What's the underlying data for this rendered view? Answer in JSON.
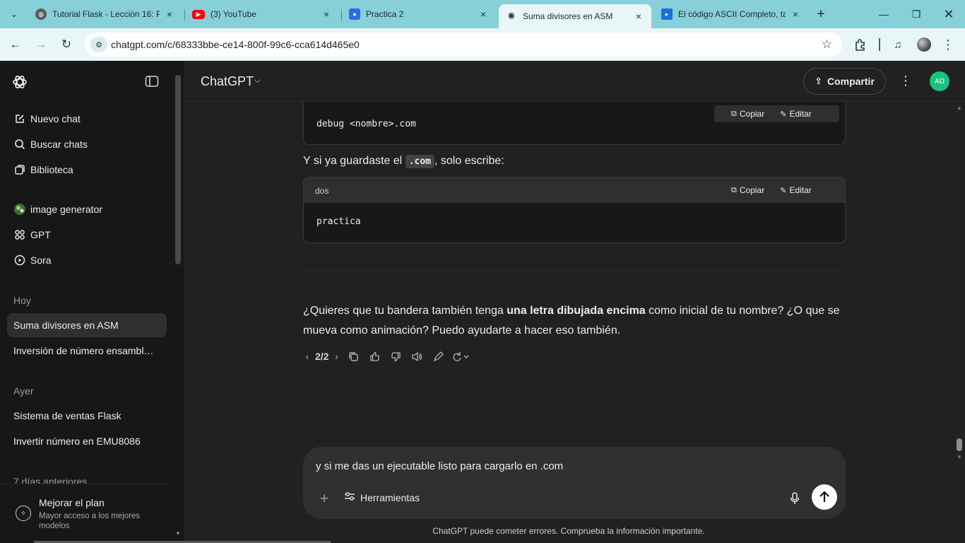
{
  "browser": {
    "tabs": [
      {
        "title": "Tutorial Flask - Lección 16: P",
        "icon": "generic-site-icon"
      },
      {
        "title": "(3) YouTube",
        "icon": "youtube-icon"
      },
      {
        "title": "Practica 2",
        "icon": "classroom-icon"
      },
      {
        "title": "Suma divisores en ASM",
        "icon": "chatgpt-icon",
        "active": true
      },
      {
        "title": "El código ASCII Completo, ta",
        "icon": "video-icon"
      }
    ],
    "url_host": "chatgpt.com",
    "url_path": "/c/68333bbe-ce14-800f-99c6-cca614d465e0"
  },
  "sidebar": {
    "nav": [
      {
        "label": "Nuevo chat",
        "icon": "new-chat-icon"
      },
      {
        "label": "Buscar chats",
        "icon": "search-icon"
      },
      {
        "label": "Biblioteca",
        "icon": "library-icon"
      }
    ],
    "gpts": [
      {
        "label": "image generator",
        "icon": "image-generator-icon"
      },
      {
        "label": "GPT",
        "icon": "gpt-grid-icon"
      },
      {
        "label": "Sora",
        "icon": "sora-icon"
      }
    ],
    "sections": [
      {
        "heading": "Hoy",
        "items": [
          "Suma divisores en ASM",
          "Inversión de número ensambl…"
        ]
      },
      {
        "heading": "Ayer",
        "items": [
          "Sistema de ventas Flask",
          "Invertir número en EMU8086"
        ]
      },
      {
        "heading": "7 días anteriores",
        "items": []
      }
    ],
    "upgrade_title": "Mejorar el plan",
    "upgrade_subtitle": "Mayor acceso a los mejores modelos"
  },
  "header": {
    "model": "ChatGPT",
    "share_label": "Compartir",
    "avatar_initials": "AD",
    "avatar_color": "#19c37d"
  },
  "conversation": {
    "code1": "debug <nombre>.com",
    "copy_label": "Copiar",
    "edit_label": "Editar",
    "para1_before": "Y si ya guardaste el ",
    "para1_code": ".com",
    "para1_after": ", solo escribe:",
    "code2_lang": "dos",
    "code2": "practica",
    "question_before": "¿Quieres que tu bandera también tenga ",
    "question_bold": "una letra dibujada encima",
    "question_after": " como inicial de tu nombre? ¿O que se mueva como animación? Puedo ayudarte a hacer eso también.",
    "pager": "2/2"
  },
  "composer": {
    "text": "y si me das un ejecutable listo para cargarlo en .com",
    "tools_label": "Herramientas"
  },
  "disclaimer": "ChatGPT puede cometer errores. Comprueba la información importante."
}
